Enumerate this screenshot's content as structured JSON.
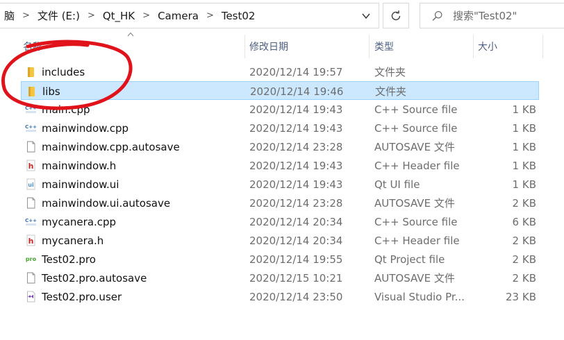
{
  "address": {
    "crumbs": [
      "脑",
      "文件 (E:)",
      "Qt_HK",
      "Camera",
      "Test02"
    ],
    "separator": ">"
  },
  "search": {
    "placeholder": "搜索\"Test02\""
  },
  "columns": {
    "name": "名称",
    "date": "修改日期",
    "type": "类型",
    "size": "大小"
  },
  "files": [
    {
      "name": "includes",
      "date": "2020/12/14 19:57",
      "type": "文件夹",
      "size": "",
      "icon": "folder-icon"
    },
    {
      "name": "libs",
      "date": "2020/12/14 19:46",
      "type": "文件夹",
      "size": "",
      "icon": "folder-icon"
    },
    {
      "name": "main.cpp",
      "date": "2020/12/14 19:43",
      "type": "C++ Source file",
      "size": "1 KB",
      "icon": "cpp-file-icon"
    },
    {
      "name": "mainwindow.cpp",
      "date": "2020/12/14 19:43",
      "type": "C++ Source file",
      "size": "1 KB",
      "icon": "cpp-file-icon"
    },
    {
      "name": "mainwindow.cpp.autosave",
      "date": "2020/12/14 23:28",
      "type": "AUTOSAVE 文件",
      "size": "1 KB",
      "icon": "blank-file-icon"
    },
    {
      "name": "mainwindow.h",
      "date": "2020/12/14 19:43",
      "type": "C++ Header file",
      "size": "1 KB",
      "icon": "header-file-icon"
    },
    {
      "name": "mainwindow.ui",
      "date": "2020/12/14 19:43",
      "type": "Qt UI file",
      "size": "1 KB",
      "icon": "ui-file-icon"
    },
    {
      "name": "mainwindow.ui.autosave",
      "date": "2020/12/14 23:28",
      "type": "AUTOSAVE 文件",
      "size": "2 KB",
      "icon": "blank-file-icon"
    },
    {
      "name": "mycanera.cpp",
      "date": "2020/12/14 20:34",
      "type": "C++ Source file",
      "size": "6 KB",
      "icon": "cpp-file-icon"
    },
    {
      "name": "mycanera.h",
      "date": "2020/12/14 20:34",
      "type": "C++ Header file",
      "size": "2 KB",
      "icon": "header-file-icon"
    },
    {
      "name": "Test02.pro",
      "date": "2020/12/14 19:55",
      "type": "Qt Project file",
      "size": "2 KB",
      "icon": "pro-file-icon"
    },
    {
      "name": "Test02.pro.autosave",
      "date": "2020/12/15 10:21",
      "type": "AUTOSAVE 文件",
      "size": "2 KB",
      "icon": "blank-file-icon"
    },
    {
      "name": "Test02.pro.user",
      "date": "2020/12/14 23:50",
      "type": "Visual Studio Pr...",
      "size": "23 KB",
      "icon": "visual-studio-file-icon"
    }
  ],
  "selected_index": 1,
  "colors": {
    "selection_bg": "#cce8ff",
    "selection_border": "#99d1ff",
    "annotation": "#e0131b",
    "header_text": "#4d6082"
  }
}
